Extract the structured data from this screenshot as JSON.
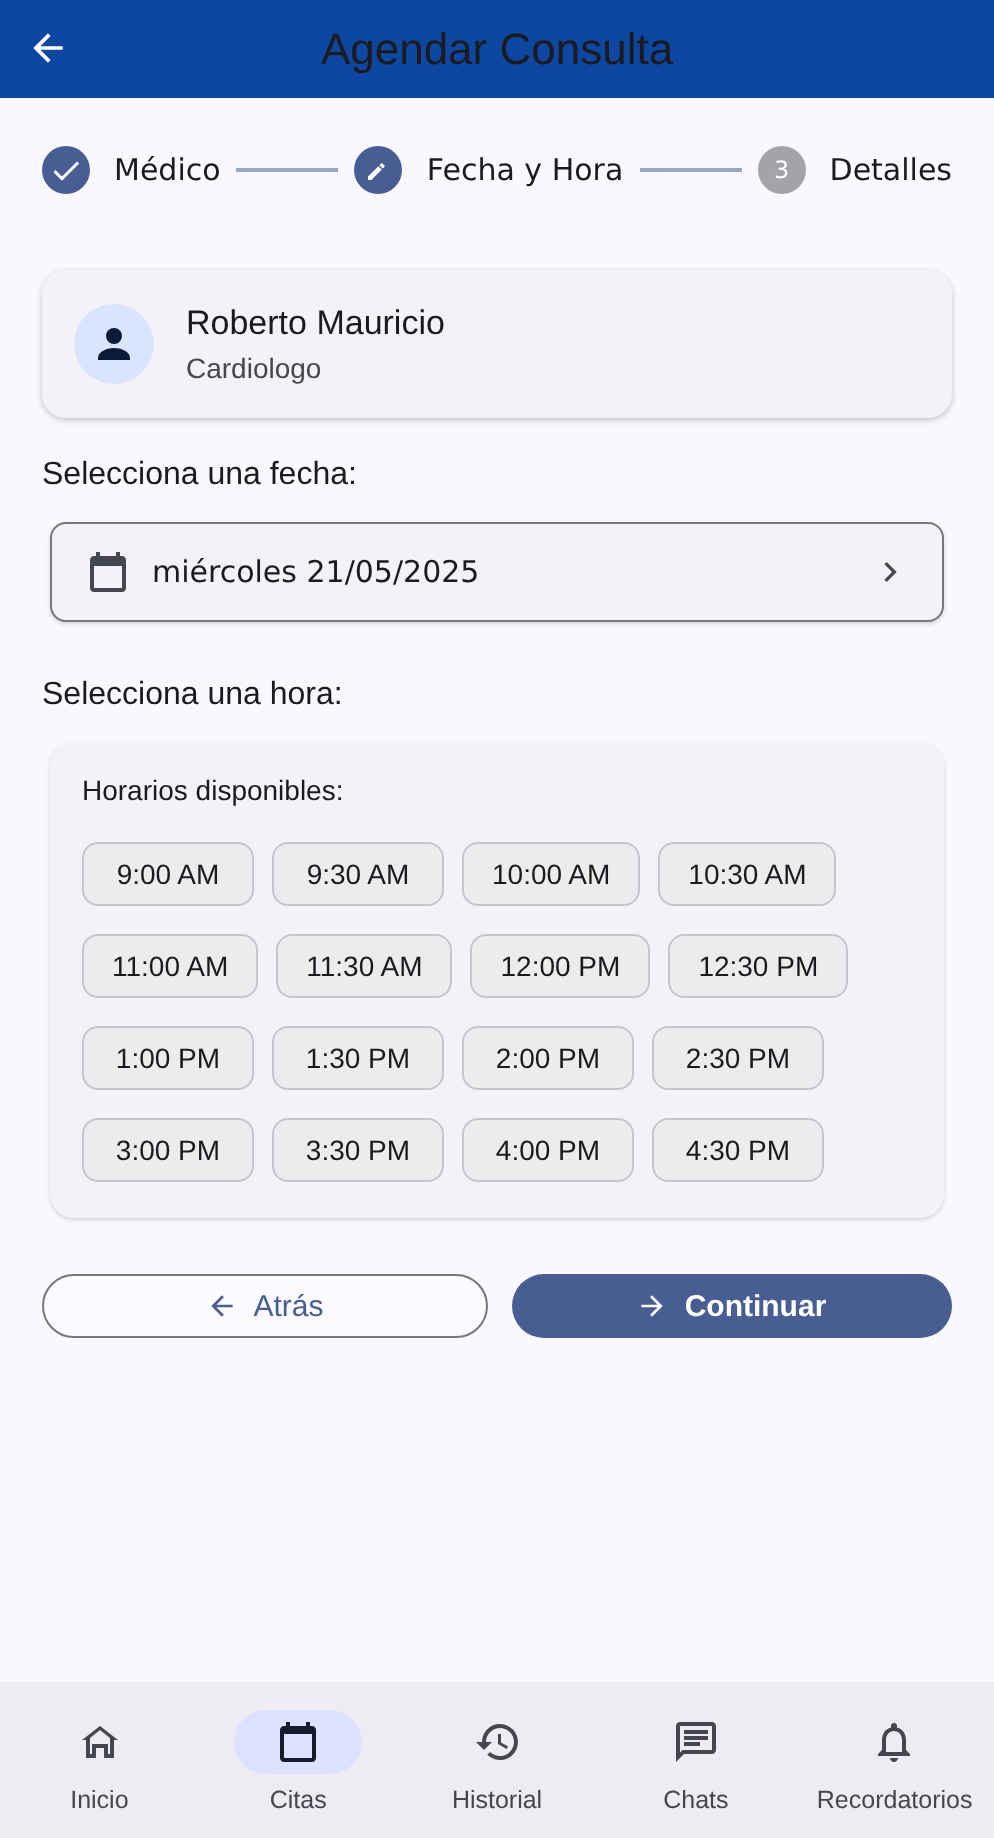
{
  "app_bar": {
    "title": "Agendar Consulta"
  },
  "steps": [
    {
      "label": "Médico",
      "kind": "done"
    },
    {
      "label": "Fecha y Hora",
      "kind": "current"
    },
    {
      "label": "Detalles",
      "kind": "pending",
      "number": "3"
    }
  ],
  "doctor": {
    "name": "Roberto Mauricio",
    "specialty": "Cardiologo"
  },
  "date_section": {
    "label": "Selecciona una fecha:",
    "value": "miércoles 21/05/2025"
  },
  "time_section": {
    "label": "Selecciona una hora:",
    "panel_title": "Horarios disponibles:",
    "rows": [
      [
        {
          "label": "9:00 AM",
          "selected": false
        },
        {
          "label": "9:30 AM",
          "selected": false
        },
        {
          "label": "10:00 AM",
          "selected": false
        },
        {
          "label": "10:30 AM",
          "selected": false
        }
      ],
      [
        {
          "label": "11:00 AM",
          "selected": false
        },
        {
          "label": "11:30 AM",
          "selected": false
        },
        {
          "label": "12:00 PM",
          "selected": false
        },
        {
          "label": "12:30 PM",
          "selected": false
        }
      ],
      [
        {
          "label": "1:00 PM",
          "selected": false
        },
        {
          "label": "1:30 PM",
          "selected": false
        },
        {
          "label": "2:00 PM",
          "selected": false
        },
        {
          "label": "2:30 PM",
          "selected": false
        }
      ],
      [
        {
          "label": "3:00 PM",
          "selected": false
        },
        {
          "label": "3:30 PM",
          "selected": false
        },
        {
          "label": "4:00 PM",
          "selected": false
        },
        {
          "label": "4:30 PM",
          "selected": false
        }
      ]
    ]
  },
  "actions": {
    "back": "Atrás",
    "next": "Continuar"
  },
  "nav": [
    {
      "label": "Inicio",
      "kind": "home",
      "selected": false
    },
    {
      "label": "Citas",
      "kind": "calendar",
      "selected": true
    },
    {
      "label": "Historial",
      "kind": "history",
      "selected": false
    },
    {
      "label": "Chats",
      "kind": "chat",
      "selected": false
    },
    {
      "label": "Recordatorios",
      "kind": "bell",
      "selected": false
    }
  ]
}
